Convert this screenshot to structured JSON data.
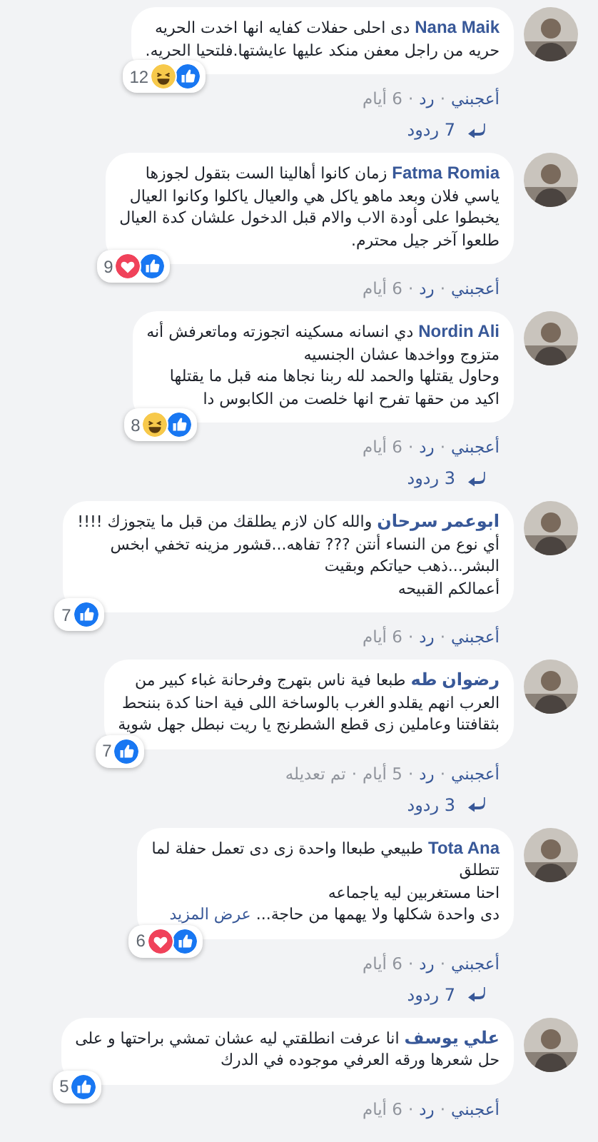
{
  "comments": [
    {
      "name": "Nana Maik",
      "text": "دى احلى حفلات كفايه انها اخدت الحريه\nحريه من راجل معفن منكد عليها عايشتها.فلتحيا الحريه.",
      "reactions": [
        {
          "kind": "like"
        },
        {
          "kind": "haha"
        }
      ],
      "reaction_count": "12",
      "meta": [
        {
          "kind": "link",
          "text": "أعجبني"
        },
        {
          "kind": "sep",
          "text": "·"
        },
        {
          "kind": "link",
          "text": "رد"
        },
        {
          "kind": "sep",
          "text": "·"
        },
        {
          "kind": "time",
          "text": "6 أيام"
        }
      ],
      "replies": "7 ردود"
    },
    {
      "name": "Fatma Romia",
      "text": "زمان كانوا أهالينا الست بتقول لجوزها\nياسي فلان وبعد ماهو ياكل هي والعيال ياكلوا وكانوا العيال\nيخبطوا على أودة الاب والام قبل الدخول علشان كدة العيال\nطلعوا آخر جيل محترم.",
      "reactions": [
        {
          "kind": "like"
        },
        {
          "kind": "love"
        }
      ],
      "reaction_count": "9",
      "meta": [
        {
          "kind": "link",
          "text": "أعجبني"
        },
        {
          "kind": "sep",
          "text": "·"
        },
        {
          "kind": "link",
          "text": "رد"
        },
        {
          "kind": "sep",
          "text": "·"
        },
        {
          "kind": "time",
          "text": "6 أيام"
        }
      ]
    },
    {
      "name": "Nordin Ali",
      "text": "دي انسانه مسكينه اتجوزته وماتعرفش أنه\nمتزوج وواخدها عشان الجنسيه\nوحاول يقتلها والحمد لله ربنا نجاها منه قبل ما يقتلها\nاكيد من حقها تفرح انها خلصت من الكابوس دا",
      "reactions": [
        {
          "kind": "like"
        },
        {
          "kind": "haha"
        }
      ],
      "reaction_count": "8",
      "meta": [
        {
          "kind": "link",
          "text": "أعجبني"
        },
        {
          "kind": "sep",
          "text": "·"
        },
        {
          "kind": "link",
          "text": "رد"
        },
        {
          "kind": "sep",
          "text": "·"
        },
        {
          "kind": "time",
          "text": "6 أيام"
        }
      ],
      "replies": "3 ردود"
    },
    {
      "name": "ابوعمر سرحان",
      "text": "والله كان لازم يطلقك من قبل ما يتجوزك !!!!\nأي نوع من النساء أنتن ??? تفاهه...قشور مزينه تخفي ابخس\nالبشر...ذهب حياتكم وبقيت\nأعمالكم القبيحه",
      "reactions": [
        {
          "kind": "like"
        }
      ],
      "reaction_count": "7",
      "meta": [
        {
          "kind": "link",
          "text": "أعجبني"
        },
        {
          "kind": "sep",
          "text": "·"
        },
        {
          "kind": "link",
          "text": "رد"
        },
        {
          "kind": "sep",
          "text": "·"
        },
        {
          "kind": "time",
          "text": "6 أيام"
        }
      ]
    },
    {
      "name": "رضوان طه",
      "text": "طبعا فية ناس بتهرج وفرحانة غباء كبير من\nالعرب انهم يقلدو الغرب بالوساخة اللى فية احنا كدة بننحط\nبثقافتنا وعاملين زى قطع الشطرنج يا ريت نبطل جهل شوية",
      "reactions": [
        {
          "kind": "like"
        }
      ],
      "reaction_count": "7",
      "meta": [
        {
          "kind": "link",
          "text": "أعجبني"
        },
        {
          "kind": "sep",
          "text": "·"
        },
        {
          "kind": "link",
          "text": "رد"
        },
        {
          "kind": "sep",
          "text": "·"
        },
        {
          "kind": "time",
          "text": "5 أيام"
        },
        {
          "kind": "sep",
          "text": "·"
        },
        {
          "kind": "time",
          "text": "تم تعديله"
        }
      ],
      "replies": "3 ردود"
    },
    {
      "name": "Tota Ana",
      "text": "طبيعي طبعاا واحدة زى دى تعمل حفلة لما\nتتطلق\nاحنا مستغربين ليه ياجماعه\nدى واحدة شكلها ولا يهمها من حاجة... ",
      "see_more": "عرض المزيد",
      "reactions": [
        {
          "kind": "like"
        },
        {
          "kind": "love"
        }
      ],
      "reaction_count": "6",
      "meta": [
        {
          "kind": "link",
          "text": "أعجبني"
        },
        {
          "kind": "sep",
          "text": "·"
        },
        {
          "kind": "link",
          "text": "رد"
        },
        {
          "kind": "sep",
          "text": "·"
        },
        {
          "kind": "time",
          "text": "6 أيام"
        }
      ],
      "replies": "7 ردود"
    },
    {
      "name": "علي يوسف",
      "text": "انا عرفت انطلقتي ليه عشان تمشي براحتها و على\nحل شعرها ورقه العرفي موجوده في الدرك",
      "reactions": [
        {
          "kind": "like"
        }
      ],
      "reaction_count": "5",
      "meta": [
        {
          "kind": "link",
          "text": "أعجبني"
        },
        {
          "kind": "sep",
          "text": "·"
        },
        {
          "kind": "link",
          "text": "رد"
        },
        {
          "kind": "sep",
          "text": "·"
        },
        {
          "kind": "time",
          "text": "6 أيام"
        }
      ]
    }
  ]
}
